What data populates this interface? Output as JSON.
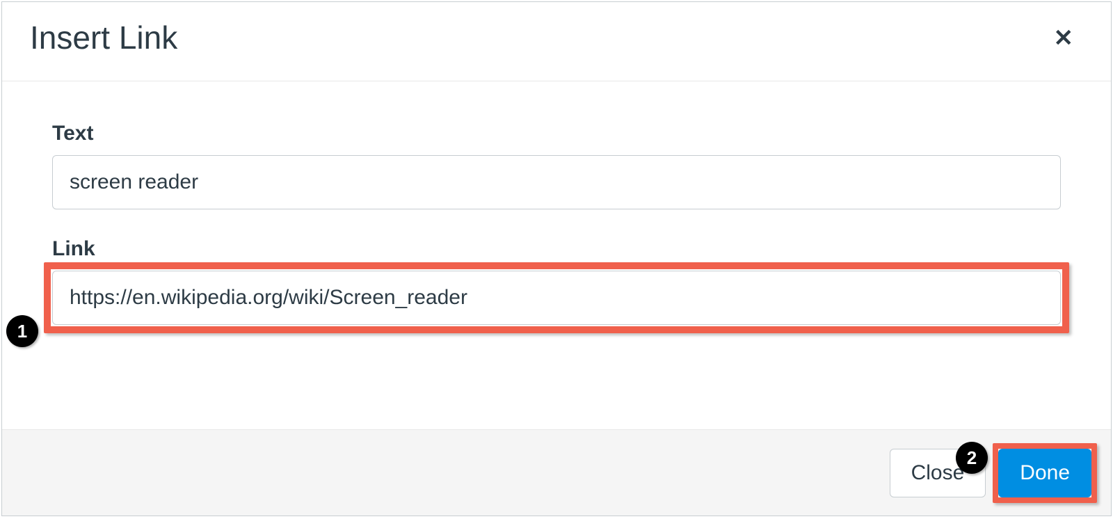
{
  "modal": {
    "title": "Insert Link",
    "close_icon": "✕"
  },
  "fields": {
    "text": {
      "label": "Text",
      "value": "screen reader"
    },
    "link": {
      "label": "Link",
      "value": "https://en.wikipedia.org/wiki/Screen_reader"
    }
  },
  "footer": {
    "close_label": "Close",
    "done_label": "Done"
  },
  "callouts": {
    "one": "1",
    "two": "2"
  }
}
